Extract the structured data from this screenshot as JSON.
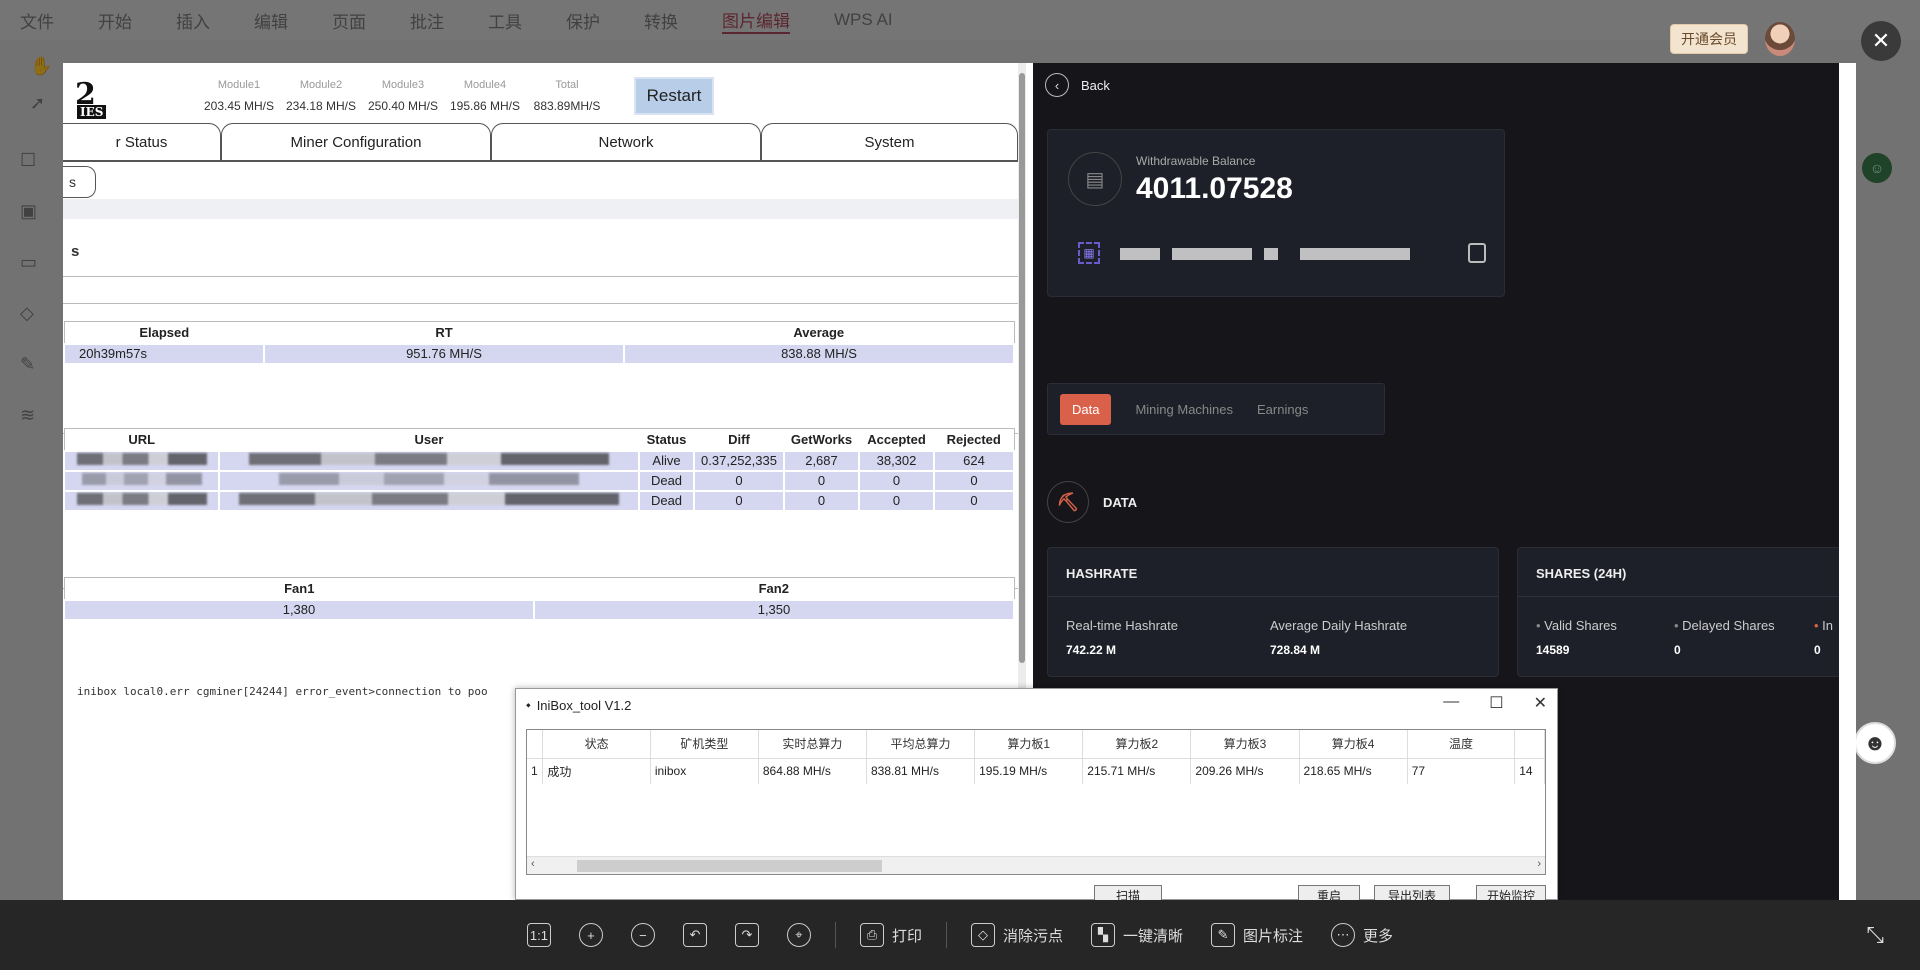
{
  "app": {
    "menu": [
      "文件",
      "开始",
      "插入",
      "编辑",
      "页面",
      "批注",
      "工具",
      "保护",
      "转换",
      "图片编辑",
      "WPS AI"
    ],
    "active_menu": "图片编辑",
    "vip_button": "开通会员"
  },
  "miner": {
    "logo": "2",
    "logo_sub": "IES",
    "modules": [
      {
        "label": "Module1",
        "value": "203.45 MH/S"
      },
      {
        "label": "Module2",
        "value": "234.18 MH/S"
      },
      {
        "label": "Module3",
        "value": "250.40 MH/S"
      },
      {
        "label": "Module4",
        "value": "195.86 MH/S"
      },
      {
        "label": "Total",
        "value": "883.89MH/S"
      }
    ],
    "restart": "Restart",
    "tabs": [
      "r Status",
      "Miner Configuration",
      "Network",
      "System"
    ],
    "subtab": "s",
    "section_letter": "s",
    "summary": {
      "headers": [
        "Elapsed",
        "RT",
        "Average"
      ],
      "row": [
        "20h39m57s",
        "951.76 MH/S",
        "838.88 MH/S"
      ]
    },
    "pools": {
      "headers": [
        "URL",
        "User",
        "Status",
        "Diff",
        "GetWorks",
        "Accepted",
        "Rejected"
      ],
      "rows": [
        {
          "status": "Alive",
          "diff": "0.37,252,335",
          "getworks": "2,687",
          "accepted": "38,302",
          "rejected": "624"
        },
        {
          "status": "Dead",
          "diff": "0",
          "getworks": "0",
          "accepted": "0",
          "rejected": "0"
        },
        {
          "status": "Dead",
          "diff": "0",
          "getworks": "0",
          "accepted": "0",
          "rejected": "0"
        }
      ]
    },
    "fans": {
      "headers": [
        "Fan1",
        "Fan2"
      ],
      "row": [
        "1,380",
        "1,350"
      ]
    },
    "log": "inibox local0.err cgminer[24244]  error_event>connection to poo"
  },
  "dark": {
    "back": "Back",
    "balance_label": "Withdrawable Balance",
    "balance_value": "4011.07528",
    "tabs": [
      "Data",
      "Mining Machines",
      "Earnings"
    ],
    "active_tab": "Data",
    "data_heading": "DATA",
    "hashrate": {
      "title": "HASHRATE",
      "realtime_label": "Real-time Hashrate",
      "realtime_value": "742.22 M",
      "average_label": "Average Daily Hashrate",
      "average_value": "728.84 M"
    },
    "shares": {
      "title": "SHARES (24H)",
      "valid_label": "Valid Shares",
      "valid_value": "14589",
      "delayed_label": "Delayed Shares",
      "delayed_value": "0",
      "invalid_label": "In",
      "invalid_value": "0"
    }
  },
  "tool": {
    "title": "IniBox_tool V1.2",
    "headers": [
      "状态",
      "矿机类型",
      "实时总算力",
      "平均总算力",
      "算力板1",
      "算力板2",
      "算力板3",
      "算力板4",
      "温度"
    ],
    "row": {
      "index": "1",
      "cells": [
        "成功",
        "inibox",
        "864.88 MH/s",
        "838.81 MH/s",
        "195.19 MH/s",
        "215.71 MH/s",
        "209.26 MH/s",
        "218.65 MH/s",
        "77",
        "14"
      ]
    },
    "buttons": [
      "扫描",
      "重启",
      "导出列表",
      "开始监控"
    ]
  },
  "toolbar": {
    "print": "打印",
    "remove_spots": "消除污点",
    "one_click_clear": "一键清晰",
    "image_annotate": "图片标注",
    "more": "更多"
  }
}
